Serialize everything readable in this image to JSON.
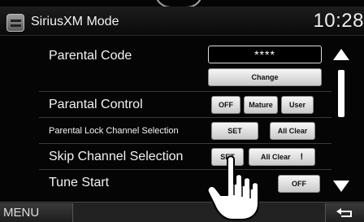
{
  "header": {
    "title": "SiriusXM Mode",
    "clock": "10:28"
  },
  "icons": {
    "app": "siriusxm-icon",
    "scroll_up": "up-arrow-icon",
    "scroll_down": "down-arrow-icon",
    "back": "back-icon",
    "pointer": "hand-pointer-icon"
  },
  "rows": {
    "parental_code": {
      "label": "Parental Code",
      "value": "****",
      "change": "Change"
    },
    "parental_control": {
      "label": "Parantal Control",
      "off": "OFF",
      "mature": "Mature",
      "user": "User"
    },
    "parental_lock": {
      "label": "Parental Lock Channel Selection",
      "set": "SET",
      "all_clear": "All Clear"
    },
    "skip_channel": {
      "label": "Skip Channel Selection",
      "set": "SET",
      "all_clear": "All Clear",
      "marker": "!"
    },
    "tune_start": {
      "label": "Tune Start",
      "off": "OFF"
    }
  },
  "bottom": {
    "menu": "MENU"
  }
}
